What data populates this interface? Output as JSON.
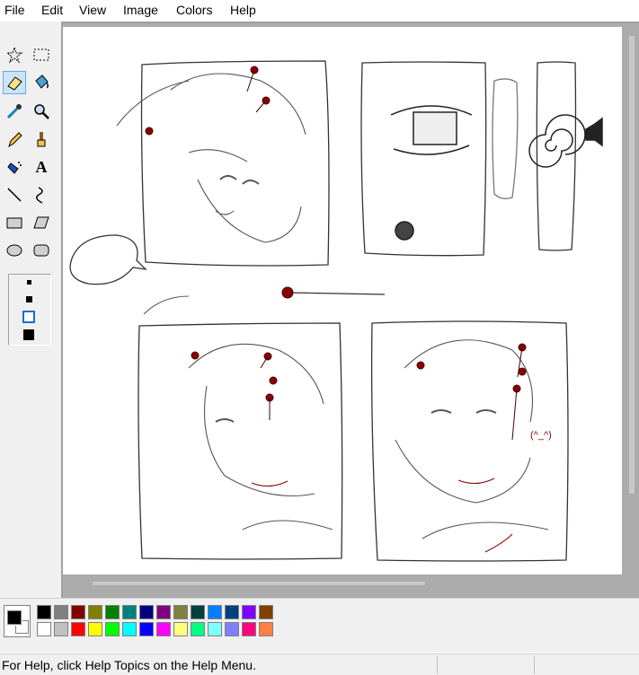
{
  "menu": {
    "file": "File",
    "edit": "Edit",
    "view": "View",
    "image": "Image",
    "colors": "Colors",
    "help": "Help"
  },
  "tools": [
    {
      "name": "free-form-select",
      "icon": "star-select-icon"
    },
    {
      "name": "select",
      "icon": "rect-select-icon"
    },
    {
      "name": "eraser",
      "icon": "eraser-icon",
      "selected": true
    },
    {
      "name": "fill-with-color",
      "icon": "paint-bucket-icon"
    },
    {
      "name": "pick-color",
      "icon": "eyedropper-icon"
    },
    {
      "name": "magnifier",
      "icon": "magnifier-icon"
    },
    {
      "name": "pencil",
      "icon": "pencil-icon"
    },
    {
      "name": "brush",
      "icon": "brush-icon"
    },
    {
      "name": "airbrush",
      "icon": "airbrush-icon"
    },
    {
      "name": "text",
      "icon": "text-icon",
      "glyph": "A"
    },
    {
      "name": "line",
      "icon": "line-icon"
    },
    {
      "name": "curve",
      "icon": "curve-icon"
    },
    {
      "name": "rectangle",
      "icon": "rectangle-icon"
    },
    {
      "name": "polygon",
      "icon": "polygon-icon"
    },
    {
      "name": "ellipse",
      "icon": "ellipse-icon"
    },
    {
      "name": "rounded-rectangle",
      "icon": "rounded-rectangle-icon"
    }
  ],
  "eraser_sizes": [
    "size-1",
    "size-2",
    "size-3",
    "size-4"
  ],
  "selected_eraser_size": "size-3",
  "colors": {
    "foreground": "#000000",
    "background": "#ffffff",
    "palette_top": [
      "#000000",
      "#808080",
      "#800000",
      "#808000",
      "#008000",
      "#008080",
      "#000080",
      "#800080",
      "#808040",
      "#004040",
      "#0080ff",
      "#004080",
      "#8000ff",
      "#804000"
    ],
    "palette_bottom": [
      "#ffffff",
      "#c0c0c0",
      "#ff0000",
      "#ffff00",
      "#00ff00",
      "#00ffff",
      "#0000ff",
      "#ff00ff",
      "#ffff80",
      "#00ff80",
      "#80ffff",
      "#8080ff",
      "#ff0080",
      "#ff8040"
    ]
  },
  "canvas": {
    "annotation": "(^_^)"
  },
  "status": {
    "help_text": "For Help, click Help Topics on the Help Menu."
  }
}
